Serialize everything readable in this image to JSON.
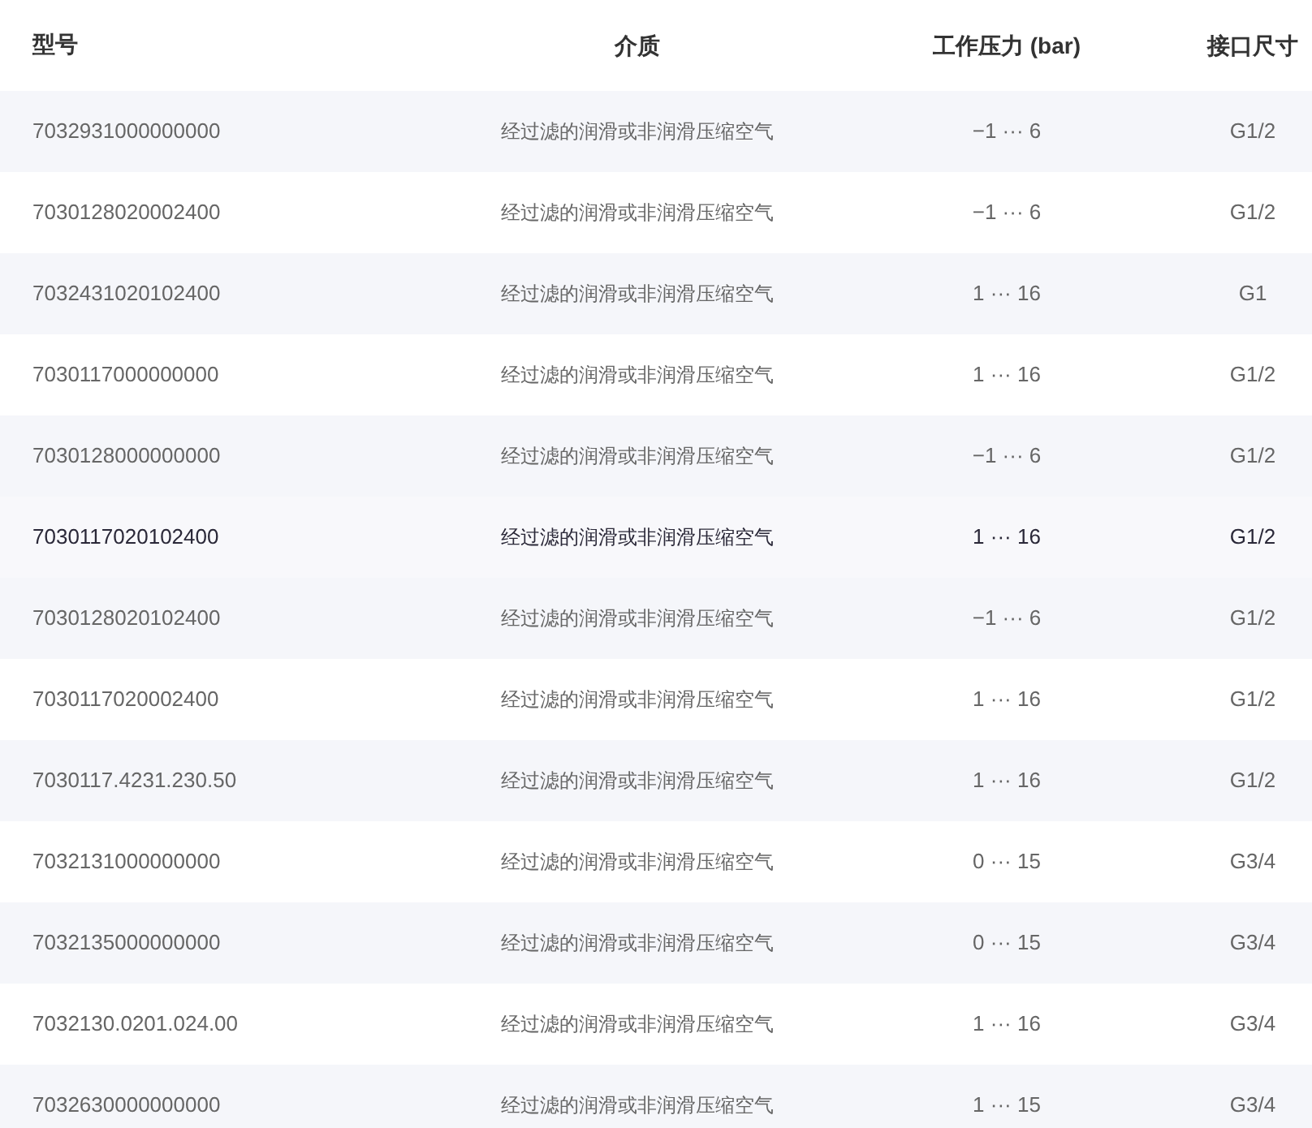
{
  "table": {
    "columns": [
      "型号",
      "介质",
      "工作压力 (bar)",
      "接口尺寸"
    ],
    "rows": [
      {
        "cells": [
          "7032931000000000",
          "经过滤的润滑或非润滑压缩空气",
          "−1 ··· 6",
          "G1/2"
        ],
        "highlighted": false
      },
      {
        "cells": [
          "7030128020002400",
          "经过滤的润滑或非润滑压缩空气",
          "−1 ··· 6",
          "G1/2"
        ],
        "highlighted": false
      },
      {
        "cells": [
          "7032431020102400",
          "经过滤的润滑或非润滑压缩空气",
          "1 ··· 16",
          "G1"
        ],
        "highlighted": false
      },
      {
        "cells": [
          "7030117000000000",
          "经过滤的润滑或非润滑压缩空气",
          "1 ··· 16",
          "G1/2"
        ],
        "highlighted": false
      },
      {
        "cells": [
          "7030128000000000",
          "经过滤的润滑或非润滑压缩空气",
          "−1 ··· 6",
          "G1/2"
        ],
        "highlighted": false
      },
      {
        "cells": [
          "7030117020102400",
          "经过滤的润滑或非润滑压缩空气",
          "1 ··· 16",
          "G1/2"
        ],
        "highlighted": true
      },
      {
        "cells": [
          "7030128020102400",
          "经过滤的润滑或非润滑压缩空气",
          "−1 ··· 6",
          "G1/2"
        ],
        "highlighted": false
      },
      {
        "cells": [
          "7030117020002400",
          "经过滤的润滑或非润滑压缩空气",
          "1 ··· 16",
          "G1/2"
        ],
        "highlighted": false
      },
      {
        "cells": [
          "7030117.4231.230.50",
          "经过滤的润滑或非润滑压缩空气",
          "1 ··· 16",
          "G1/2"
        ],
        "highlighted": false
      },
      {
        "cells": [
          "7032131000000000",
          "经过滤的润滑或非润滑压缩空气",
          "0 ··· 15",
          "G3/4"
        ],
        "highlighted": false
      },
      {
        "cells": [
          "7032135000000000",
          "经过滤的润滑或非润滑压缩空气",
          "0 ··· 15",
          "G3/4"
        ],
        "highlighted": false
      },
      {
        "cells": [
          "7032130.0201.024.00",
          "经过滤的润滑或非润滑压缩空气",
          "1 ··· 16",
          "G3/4"
        ],
        "highlighted": false
      },
      {
        "cells": [
          "7032630000000000",
          "经过滤的润滑或非润滑压缩空气",
          "1 ··· 15",
          "G3/4"
        ],
        "highlighted": false
      }
    ]
  }
}
